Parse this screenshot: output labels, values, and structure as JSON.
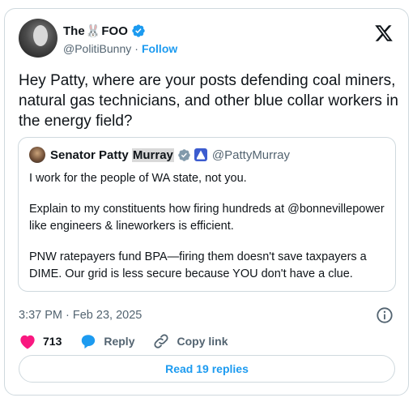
{
  "author": {
    "name_prefix": "The",
    "name_emoji": "🐰",
    "name_suffix": "FOO",
    "handle": "@PolitiBunny",
    "separator": "·",
    "follow_label": "Follow"
  },
  "tweet": {
    "text": "Hey Patty, where are your posts defending coal miners, natural gas technicians, and other blue collar workers in the energy field?"
  },
  "quote": {
    "name_first": "Senator Patty",
    "name_highlight": "Murray",
    "handle": "@PattyMurray",
    "paragraphs": [
      "I work for the people of WA state, not you.",
      "Explain to my constituents how firing hundreds at @bonnevillepower like engineers & lineworkers is efficient.",
      "PNW ratepayers fund BPA—firing them doesn't save taxpayers a DIME. Our grid is less secure because YOU don't have a clue."
    ]
  },
  "timestamp": "3:37 PM · Feb 23, 2025",
  "actions": {
    "like_count": "713",
    "reply_label": "Reply",
    "copy_label": "Copy link"
  },
  "read_replies_label": "Read 19 replies",
  "colors": {
    "accent": "#1d9bf0",
    "like": "#f91880",
    "text": "#0f1419",
    "muted": "#536471",
    "border": "#cfd9de"
  },
  "icons": [
    "verified-icon",
    "x-logo-icon",
    "info-icon",
    "heart-icon",
    "reply-bubble-icon",
    "link-icon",
    "government-badge-icon"
  ]
}
